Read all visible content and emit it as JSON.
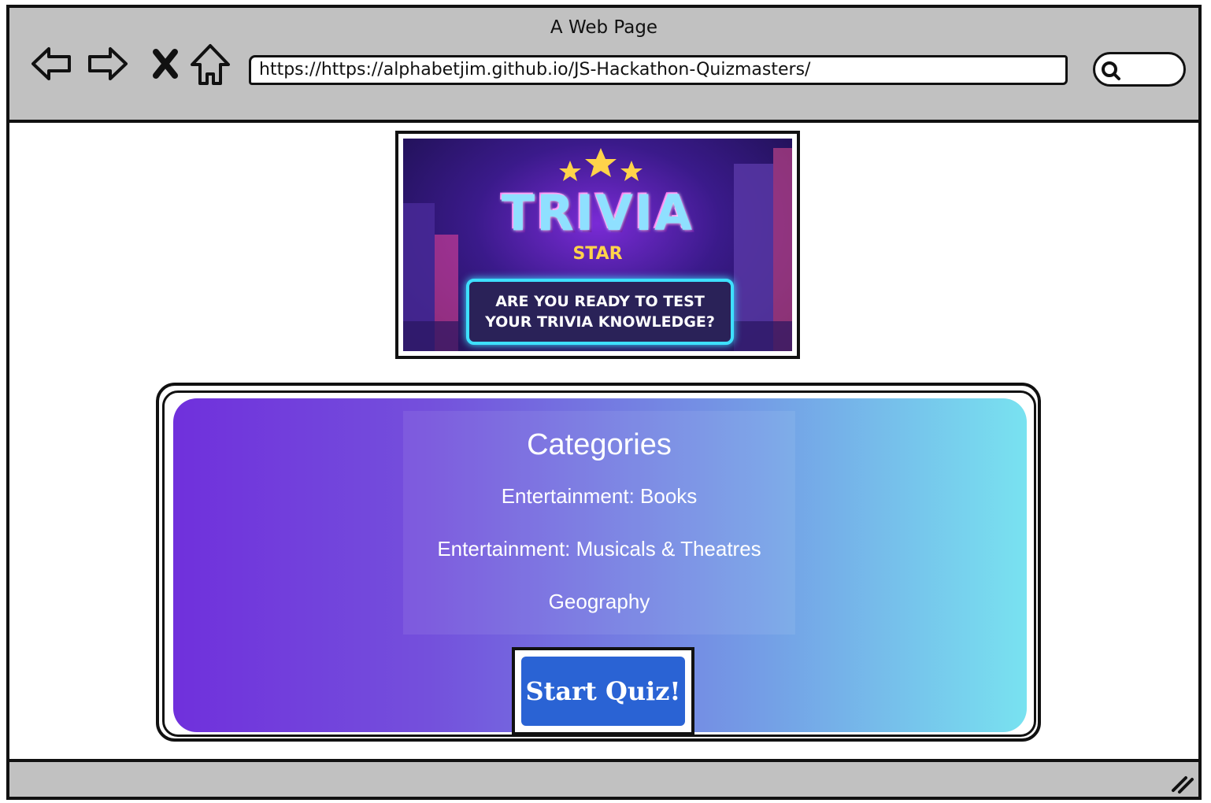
{
  "browser": {
    "title": "A Web Page",
    "url": "https://https://alphabetjim.github.io/JS-Hackathon-Quizmasters/",
    "nav_icons": [
      "back-arrow-icon",
      "forward-arrow-icon",
      "close-icon",
      "home-icon"
    ],
    "search_icon": "search-icon"
  },
  "banner": {
    "logo_word": "TRIVIA",
    "logo_sub": "STAR",
    "tagline_line1": "ARE YOU READY TO TEST",
    "tagline_line2": "YOUR TRIVIA KNOWLEDGE?"
  },
  "quiz": {
    "categories_title": "Categories",
    "categories": [
      "Entertainment: Books",
      "Entertainment: Musicals & Theatres",
      "Geography"
    ],
    "start_label": "Start Quiz!"
  },
  "colors": {
    "gradient_start": "#7030dc",
    "gradient_end": "#78e2f0",
    "button": "#2a63d4",
    "chrome": "#c1c1c1"
  }
}
